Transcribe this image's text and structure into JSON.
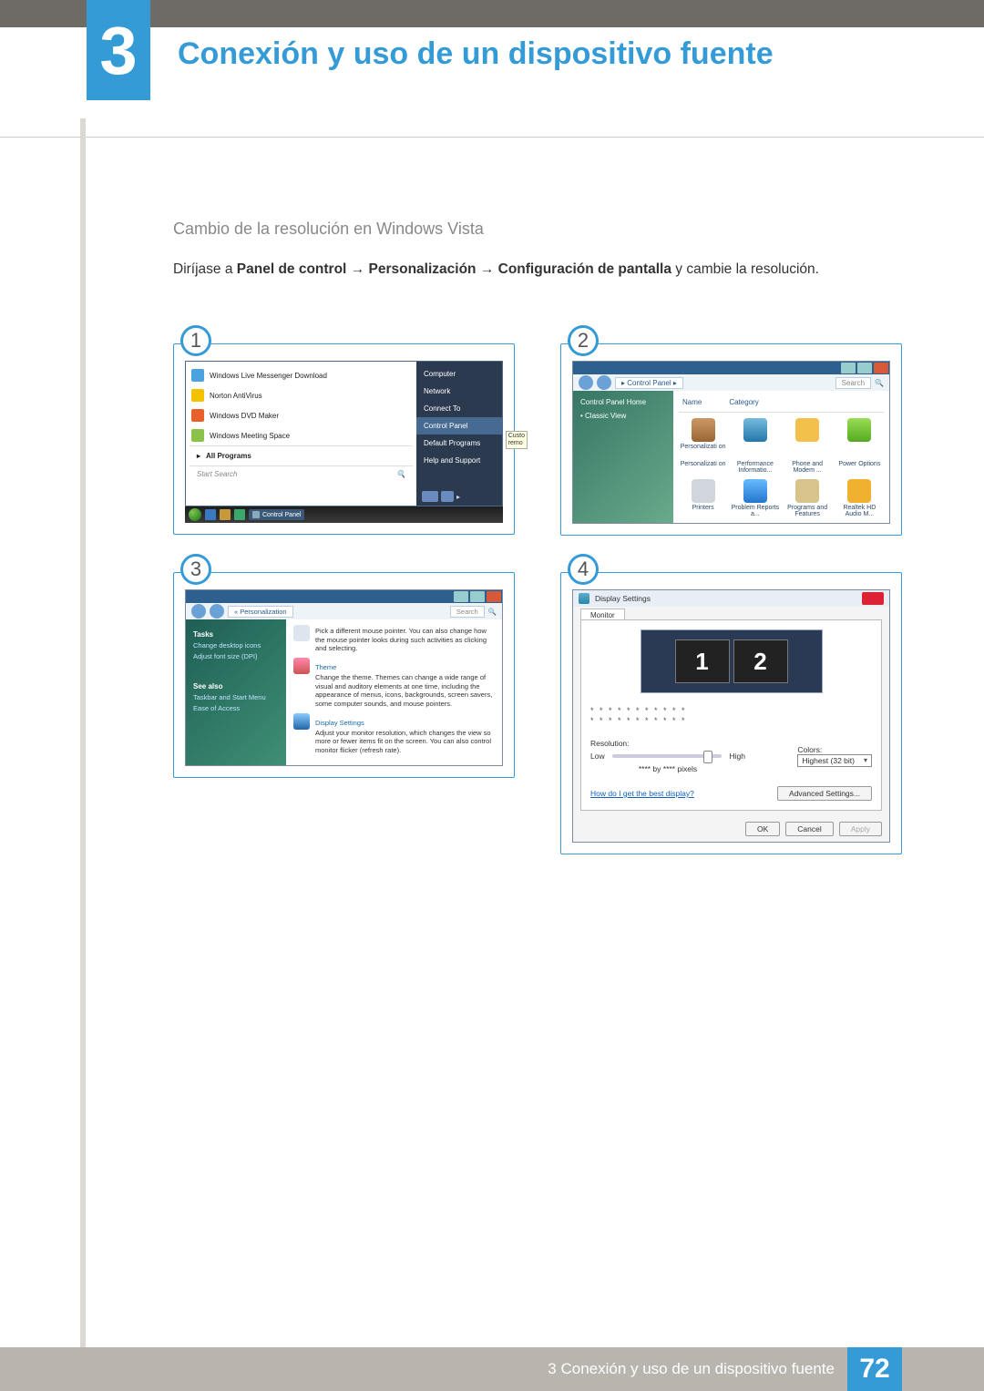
{
  "chapter": {
    "number": "3",
    "title": "Conexión y uso de un dispositivo fuente"
  },
  "section": {
    "subheading": "Cambio de la resolución en Windows Vista",
    "lead_in": "Diríjase a ",
    "path1": "Panel de control",
    "path2": "Personalización",
    "path3": "Configuración de pantalla",
    "tail": " y cambie la resolución.",
    "arrow": " → "
  },
  "figures": {
    "n1": "1",
    "n2": "2",
    "n3": "3",
    "n4": "4"
  },
  "step1": {
    "left_items": [
      "Windows Live Messenger Download",
      "Norton AntiVirus",
      "Windows DVD Maker",
      "Windows Meeting Space"
    ],
    "all_programs": "All Programs",
    "search": "Start Search",
    "right_items": [
      "Computer",
      "Network",
      "Connect To"
    ],
    "right_hl": "Control Panel",
    "right_more": [
      "Default Programs",
      "Help and Support"
    ],
    "taskbar_label": "Control Panel",
    "tooltip1": "Custo",
    "tooltip2": "remo"
  },
  "step2": {
    "breadcrumb": "▸ Control Panel ▸",
    "search": "Search",
    "side_home": "Control Panel Home",
    "side_classic": "Classic View",
    "col_name": "Name",
    "col_cat": "Category",
    "items": [
      "Personalizati on",
      "Performance Informatio...",
      "Phone and Modem ...",
      "Power Options",
      "Printers",
      "Problem Reports a...",
      "Programs and Features",
      "Realtek HD Audio M..."
    ]
  },
  "step3": {
    "breadcrumb": "« Personalization",
    "search": "Search",
    "side_tasks": "Tasks",
    "side_links": [
      "Change desktop icons",
      "Adjust font size (DPI)"
    ],
    "see_also": "See also",
    "see_links": [
      "Taskbar and Start Menu",
      "Ease of Access"
    ],
    "mouse_p": "Pick a different mouse pointer. You can also change how the mouse pointer looks during such activities as clicking and selecting.",
    "theme_t": "Theme",
    "theme_p": "Change the theme. Themes can change a wide range of visual and auditory elements at one time, including the appearance of menus, icons, backgrounds, screen savers, some computer sounds, and mouse pointers.",
    "ds_t": "Display Settings",
    "ds_p": "Adjust your monitor resolution, which changes the view so more or fewer items fit on the screen. You can also control monitor flicker (refresh rate)."
  },
  "step4": {
    "title": "Display Settings",
    "tab": "Monitor",
    "mon1": "1",
    "mon2": "2",
    "dots": "* * * * * * * * * * *",
    "res_label": "Resolution:",
    "low": "Low",
    "high": "High",
    "res_text": "**** by **** pixels",
    "colors_label": "Colors:",
    "colors_value": "Highest (32 bit)",
    "help_link": "How do I get the best display?",
    "adv": "Advanced Settings...",
    "ok": "OK",
    "cancel": "Cancel",
    "apply": "Apply"
  },
  "footer": {
    "text": "3 Conexión y uso de un dispositivo fuente",
    "page": "72"
  }
}
